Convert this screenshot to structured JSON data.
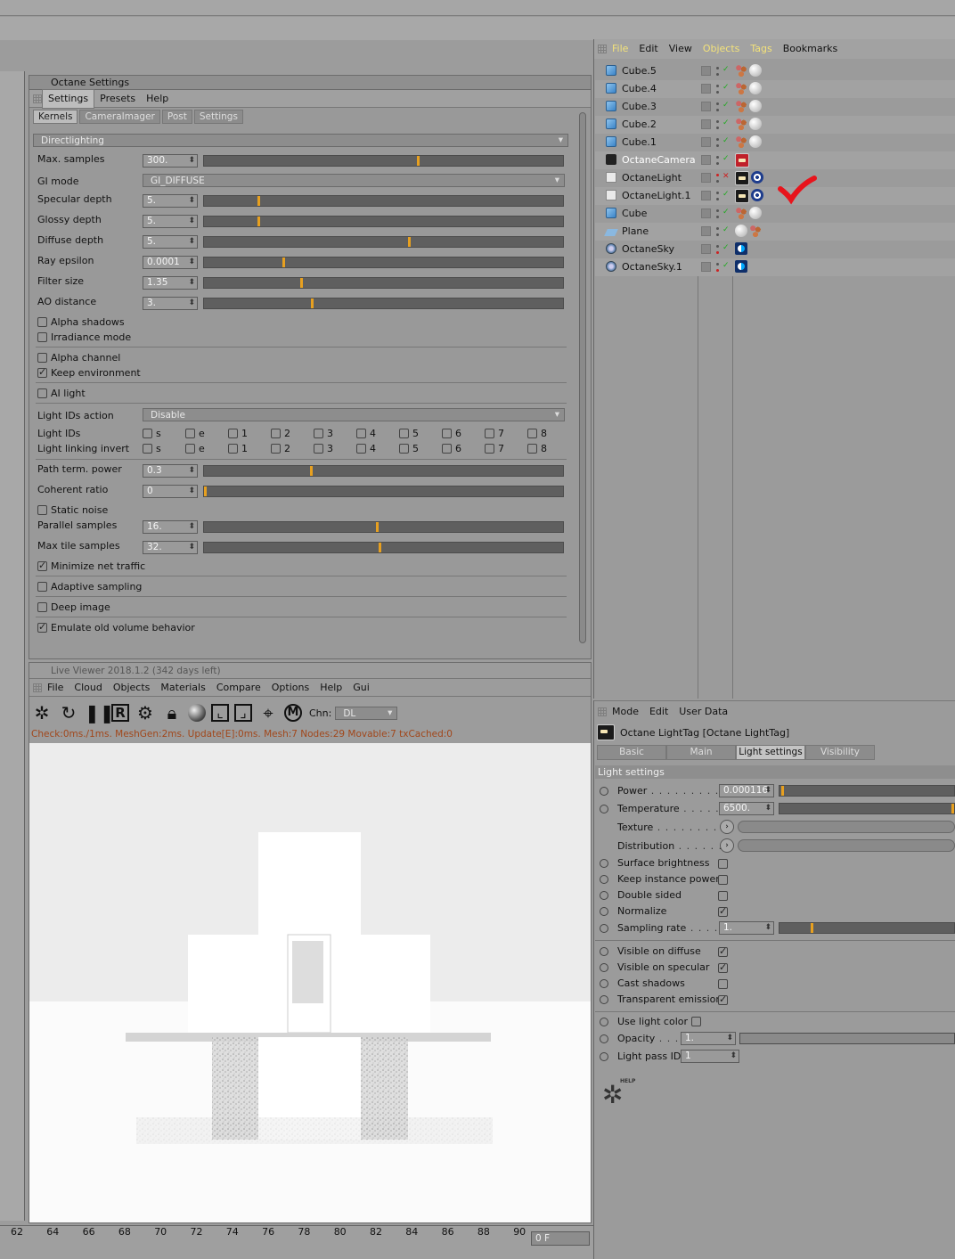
{
  "octane_settings": {
    "title": "Octane Settings",
    "menu": [
      "Settings",
      "Presets",
      "Help"
    ],
    "tabs": [
      "Kernels",
      "CameraImager",
      "Post",
      "Settings"
    ],
    "kernel": "Directlighting",
    "params": [
      {
        "label": "Max. samples",
        "value": "300.",
        "fraction": 0.59
      },
      {
        "label": "GI mode",
        "value": "GI_DIFFUSE"
      },
      {
        "label": "Specular depth",
        "value": "5.",
        "fraction": 0.15
      },
      {
        "label": "Glossy depth",
        "value": "5.",
        "fraction": 0.15
      },
      {
        "label": "Diffuse depth",
        "value": "5.",
        "fraction": 0.57
      },
      {
        "label": "Ray epsilon",
        "value": "0.0001",
        "fraction": 0.22
      },
      {
        "label": "Filter size",
        "value": "1.35",
        "fraction": 0.27
      },
      {
        "label": "AO distance",
        "value": "3.",
        "fraction": 0.3
      }
    ],
    "checks1": [
      {
        "label": "Alpha shadows",
        "on": false
      },
      {
        "label": "Irradiance mode",
        "on": false
      }
    ],
    "checks2": [
      {
        "label": "Alpha channel",
        "on": false
      },
      {
        "label": "Keep environment",
        "on": true
      }
    ],
    "ai_light": "AI light",
    "light_ids_action_label": "Light IDs action",
    "light_ids_action_value": "Disable",
    "light_ids_label": "Light IDs",
    "light_linking_label": "Light linking invert",
    "id_options": [
      "s",
      "e",
      "1",
      "2",
      "3",
      "4",
      "5",
      "6",
      "7",
      "8"
    ],
    "params2": [
      {
        "label": "Path term. power",
        "value": "0.3",
        "fraction": 0.3
      },
      {
        "label": "Coherent ratio",
        "value": "0",
        "fraction": 0.0
      }
    ],
    "static_noise": "Static noise",
    "params3": [
      {
        "label": "Parallel samples",
        "value": "16.",
        "fraction": 0.48
      },
      {
        "label": "Max tile samples",
        "value": "32.",
        "fraction": 0.49
      }
    ],
    "minimize": "Minimize net traffic",
    "adaptive": "Adaptive sampling",
    "deep": "Deep image",
    "emulate": "Emulate old volume behavior"
  },
  "objects": {
    "menu": [
      "File",
      "Edit",
      "View",
      "Objects",
      "Tags",
      "Bookmarks"
    ],
    "items": [
      "Cube.5",
      "Cube.4",
      "Cube.3",
      "Cube.2",
      "Cube.1",
      "OctaneCamera",
      "OctaneLight",
      "OctaneLight.1",
      "Cube",
      "Plane",
      "OctaneSky",
      "OctaneSky.1"
    ]
  },
  "live_viewer": {
    "title": "Live Viewer 2018.1.2 (342 days left)",
    "menu": [
      "File",
      "Cloud",
      "Objects",
      "Materials",
      "Compare",
      "Options",
      "Help",
      "Gui"
    ],
    "chn_label": "Chn:",
    "chn_value": "DL",
    "status": "Check:0ms./1ms. MeshGen:2ms. Update[E]:0ms. Mesh:7 Nodes:29 Movable:7 txCached:0"
  },
  "attributes": {
    "menu": [
      "Mode",
      "Edit",
      "User Data"
    ],
    "tag_title": "Octane LightTag [Octane LightTag]",
    "tabs": [
      "Basic",
      "Main",
      "Light settings",
      "Visibility"
    ],
    "section": "Light settings",
    "power_label": "Power",
    "power_value": "0.000116",
    "temp_label": "Temperature",
    "temp_value": "6500.",
    "texture_label": "Texture",
    "distribution_label": "Distribution",
    "checks": [
      {
        "label": "Surface brightness",
        "on": false
      },
      {
        "label": "Keep instance power",
        "on": false
      },
      {
        "label": "Double sided",
        "on": false
      },
      {
        "label": "Normalize",
        "on": true
      }
    ],
    "sampling_label": "Sampling rate",
    "sampling_value": "1.",
    "vis": [
      {
        "label": "Visible on diffuse",
        "on": true
      },
      {
        "label": "Visible on specular",
        "on": true
      },
      {
        "label": "Cast shadows",
        "on": false
      },
      {
        "label": "Transparent emission",
        "on": true
      }
    ],
    "use_light_color": "Use light color",
    "opacity_label": "Opacity",
    "opacity_value": "1.",
    "pass_label": "Light pass ID",
    "pass_value": "1",
    "help": "HELP"
  },
  "timeline": {
    "ticks": [
      "62",
      "64",
      "66",
      "68",
      "70",
      "72",
      "74",
      "76",
      "78",
      "80",
      "82",
      "84",
      "86",
      "88",
      "90"
    ],
    "frame": "0 F"
  },
  "colors": {
    "accent": "#e7a020",
    "annotation": "#e8141c"
  }
}
